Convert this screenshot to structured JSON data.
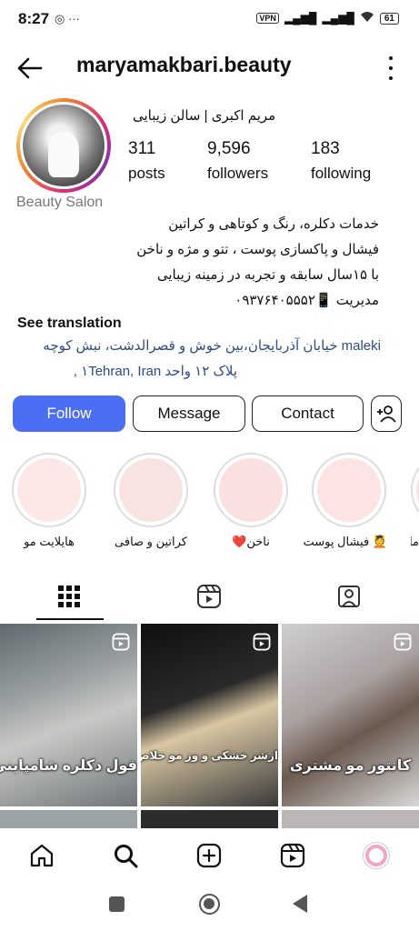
{
  "status_bar": {
    "time": "8:27",
    "vpn": "VPN",
    "battery": "61"
  },
  "header": {
    "username": "maryamakbari.beauty"
  },
  "profile": {
    "full_name": "مریم اکبری | سالن زیبایی",
    "posts_count": "311",
    "posts_label": "posts",
    "followers_count": "9,596",
    "followers_label": "followers",
    "following_count": "183",
    "following_label": "following",
    "category": "Beauty Salon",
    "bio_lines": [
      "خدمات دکلره، رنگ و کوتاهی و کراتین",
      "فیشال و پاکسازی پوست ، تتو و مژه و ناخن",
      "با ۱۵سال سابقه و تجربه در زمینه زیبایی",
      "مدیریت 📱۰۹۳۷۶۴۰۵۵۵۲"
    ],
    "see_translation": "See translation",
    "address_line1": "maleki خیابان آذربایجان،بین خوش و قصرالدشت، نبش کوچه",
    "address_line2": "پلاک ۱۲ واحد ۱Tehran, Iran ,"
  },
  "actions": {
    "follow": "Follow",
    "message": "Message",
    "contact": "Contact"
  },
  "highlights": [
    {
      "label": "هایلایت مو"
    },
    {
      "label": "کراتین و صافی"
    },
    {
      "label": "ناخن❤️"
    },
    {
      "label": "💆 فیشال پوست"
    },
    {
      "label": "ما"
    }
  ],
  "tabs": [
    {
      "icon": "grid-icon"
    },
    {
      "icon": "reels-icon"
    },
    {
      "icon": "tagged-icon"
    }
  ],
  "posts": [
    {
      "caption": "فول دکلره شامپاینی"
    },
    {
      "caption": "ازشر خشکی و وز مو خلاص شو"
    },
    {
      "caption": "کانتور مو مشتری"
    }
  ],
  "bottom_nav": [
    {
      "icon": "home-icon"
    },
    {
      "icon": "search-icon"
    },
    {
      "icon": "create-icon"
    },
    {
      "icon": "reels-icon"
    },
    {
      "icon": "profile-avatar"
    }
  ],
  "colors": {
    "follow_button": "#4c6ef5",
    "link": "#2d4b8c"
  }
}
